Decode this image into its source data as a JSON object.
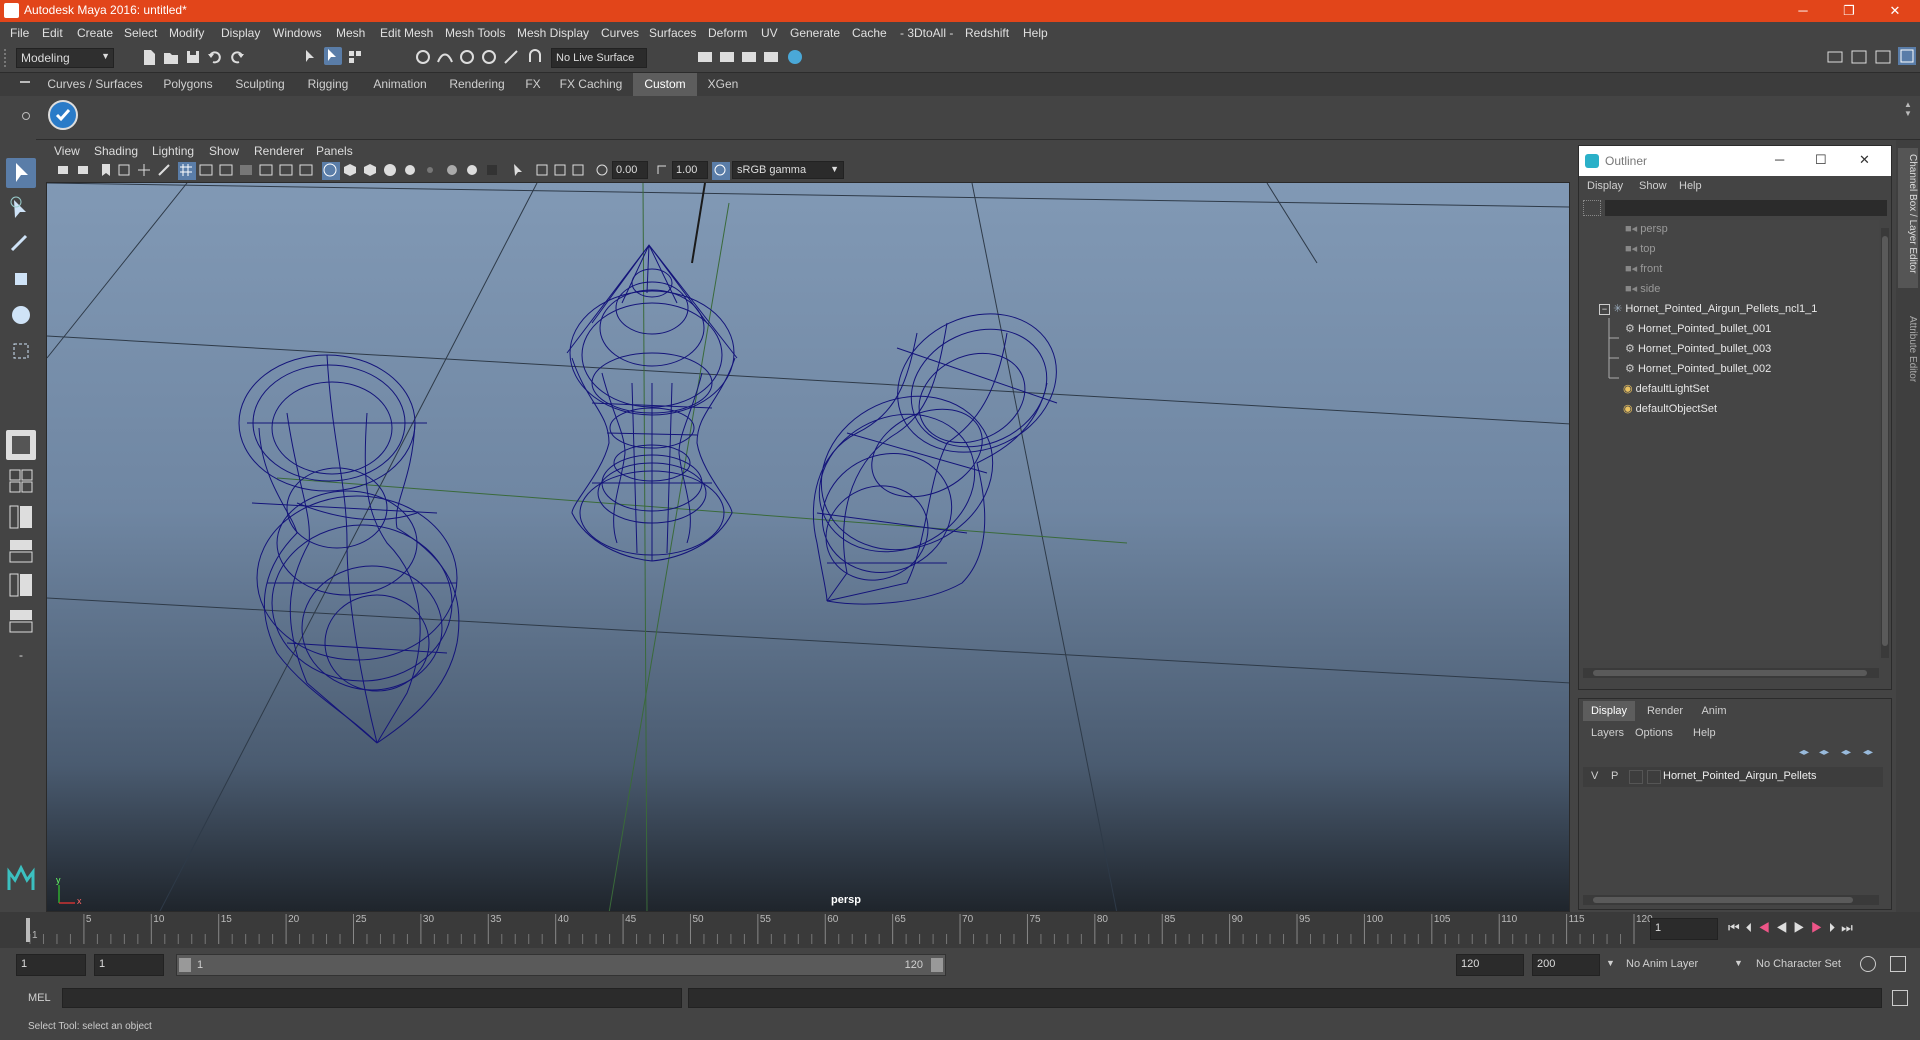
{
  "window": {
    "title": "Autodesk Maya 2016: untitled*",
    "min": "─",
    "restore": "❐",
    "close": "✕"
  },
  "menubar": [
    "File",
    "Edit",
    "Create",
    "Select",
    "Modify",
    "Display",
    "Windows",
    "Mesh",
    "Edit Mesh",
    "Mesh Tools",
    "Mesh Display",
    "Curves",
    "Surfaces",
    "Deform",
    "UV",
    "Generate",
    "Cache",
    "- 3DtoAll -",
    "Redshift",
    "Help"
  ],
  "statusline": {
    "menuset": "Modeling",
    "live_surface": "No Live Surface"
  },
  "shelf_tabs": [
    "Curves / Surfaces",
    "Polygons",
    "Sculpting",
    "Rigging",
    "Animation",
    "Rendering",
    "FX",
    "FX Caching",
    "Custom",
    "XGen"
  ],
  "shelf_active": "Custom",
  "panel_menu": [
    "View",
    "Shading",
    "Lighting",
    "Show",
    "Renderer",
    "Panels"
  ],
  "panel_toolbar": {
    "exposure": "0.00",
    "gamma": "1.00",
    "colorspace": "sRGB gamma"
  },
  "viewport": {
    "camera": "persp",
    "axis_y": "y",
    "axis_x": "x"
  },
  "outliner": {
    "title": "Outliner",
    "menu": [
      "Display",
      "Show",
      "Help"
    ],
    "items": [
      {
        "label": "persp",
        "icon": "camera-icon",
        "dim": true
      },
      {
        "label": "top",
        "icon": "camera-icon",
        "dim": true
      },
      {
        "label": "front",
        "icon": "camera-icon",
        "dim": true
      },
      {
        "label": "side",
        "icon": "camera-icon",
        "dim": true
      },
      {
        "label": "Hornet_Pointed_Airgun_Pellets_ncl1_1",
        "icon": "group-icon",
        "dim": false
      },
      {
        "label": "Hornet_Pointed_bullet_001",
        "icon": "mesh-icon",
        "dim": false
      },
      {
        "label": "Hornet_Pointed_bullet_003",
        "icon": "mesh-icon",
        "dim": false
      },
      {
        "label": "Hornet_Pointed_bullet_002",
        "icon": "mesh-icon",
        "dim": false
      },
      {
        "label": "defaultLightSet",
        "icon": "set-icon",
        "dim": false
      },
      {
        "label": "defaultObjectSet",
        "icon": "set-icon",
        "dim": false
      }
    ]
  },
  "layers": {
    "tabs": [
      "Display",
      "Render",
      "Anim"
    ],
    "active_tab": "Display",
    "menu": [
      "Layers",
      "Options",
      "Help"
    ],
    "rows": [
      {
        "v": "V",
        "p": "P",
        "name": "Hornet_Pointed_Airgun_Pellets"
      }
    ]
  },
  "right_strip": {
    "channel_box": "Channel Box / Layer Editor",
    "attribute_editor": "Attribute Editor"
  },
  "timeline": {
    "ticks": [
      "1",
      "5",
      "10",
      "15",
      "20",
      "25",
      "30",
      "35",
      "40",
      "45",
      "50",
      "55",
      "60",
      "65",
      "70",
      "75",
      "80",
      "85",
      "90",
      "95",
      "100",
      "105",
      "110",
      "115",
      "120"
    ],
    "current_frame": "1"
  },
  "range": {
    "start": "1",
    "anim_start": "1",
    "slider_start": "1",
    "slider_end": "120",
    "end": "120",
    "anim_end": "200",
    "anim_layer": "No Anim Layer",
    "character_set": "No Character Set"
  },
  "cmdline": {
    "label": "MEL"
  },
  "helpline": {
    "text": "Select Tool: select an object"
  },
  "colors": {
    "titlebar": "#e2451a",
    "wire": "#1a1a7a",
    "active_tab": "#5d5d5d"
  }
}
